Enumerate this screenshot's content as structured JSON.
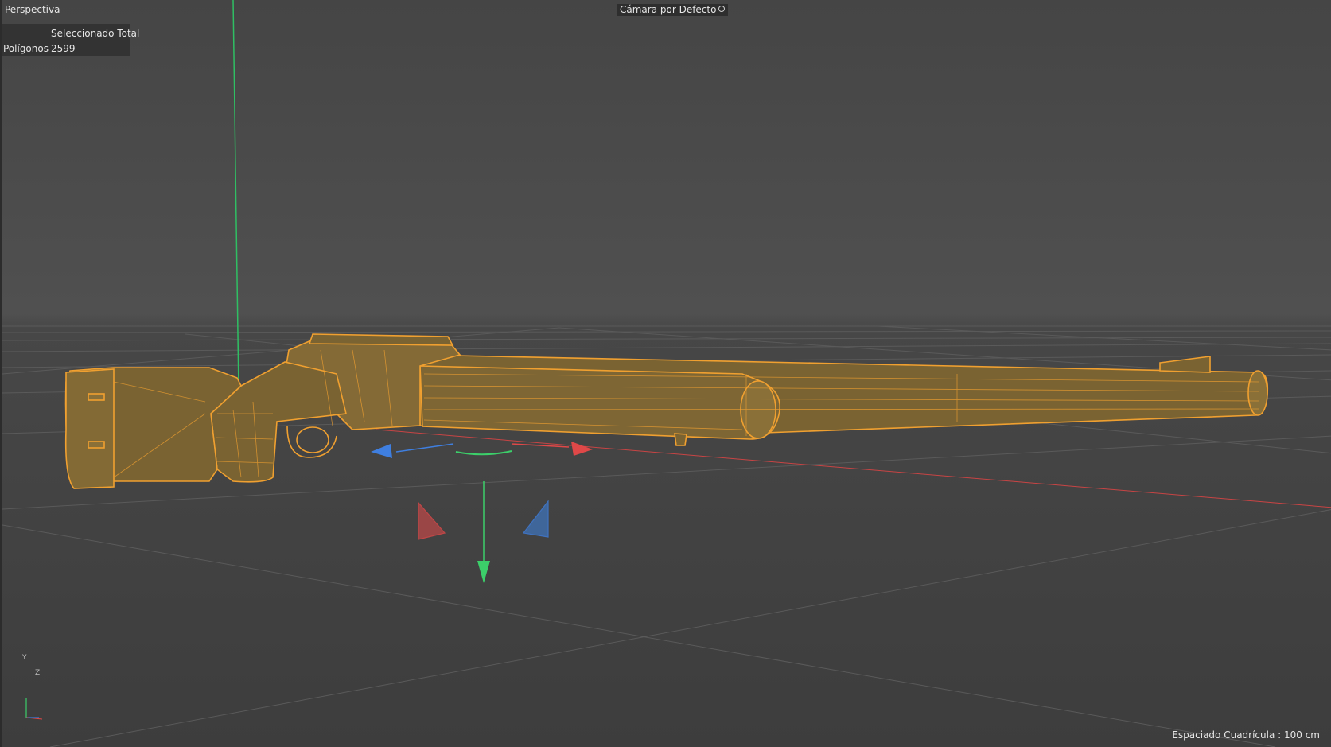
{
  "viewport": {
    "view_name": "Perspectiva",
    "camera_label": "Cámara por Defecto",
    "camera_icon": "camera-settings-icon",
    "grid_spacing": "Espaciado Cuadrícula : 100 cm"
  },
  "stats": {
    "header": "Seleccionado Total",
    "polygons_label": "Polígonos",
    "polygons_value": "2599"
  },
  "axis_indicator": {
    "y_label": "Y",
    "z_label": "Z"
  },
  "colors": {
    "selection": "#f0a030",
    "model_fill": "#7a6332",
    "axis_x": "#e04848",
    "axis_y": "#3ccf6a",
    "axis_z": "#3f7fe0",
    "grid": "#5c5c5c"
  }
}
